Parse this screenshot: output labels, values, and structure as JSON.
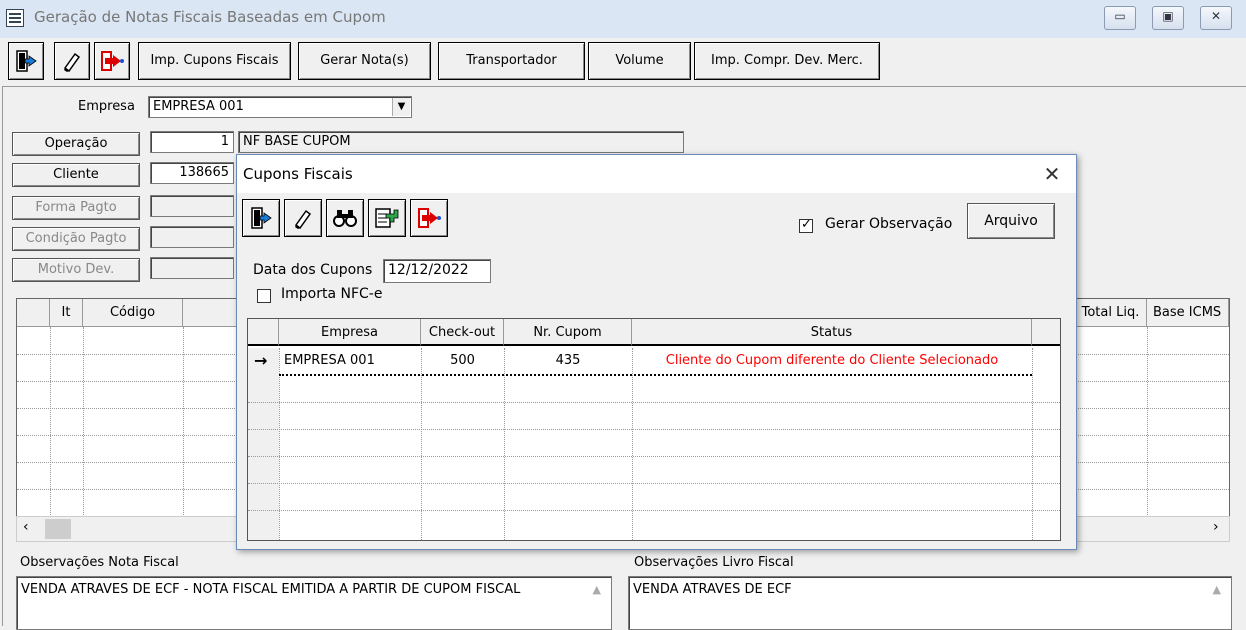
{
  "window": {
    "title": "Geração de Notas Fiscais Baseadas em Cupom",
    "minimize_icon": "minimize-icon",
    "maximize_icon": "maximize-icon",
    "close_icon": "close-icon"
  },
  "toolbar": {
    "exit_icon": "exit-door-icon",
    "clear_icon": "eraser-icon",
    "export_icon": "export-arrow-icon",
    "imp_cupons_label": "Imp. Cupons Fiscais",
    "gerar_nota_label": "Gerar Nota(s)",
    "transportador_label": "Transportador",
    "volume_label": "Volume",
    "imp_compr_label": "Imp. Compr. Dev. Merc."
  },
  "form": {
    "empresa_label": "Empresa",
    "empresa_value": "EMPRESA 001",
    "operacao_button": "Operação",
    "operacao_code": "1",
    "operacao_desc": "NF BASE CUPOM",
    "cliente_button": "Cliente",
    "cliente_code": "138665",
    "forma_pagto_button": "Forma Pagto",
    "condicao_pagto_button": "Condição Pagto",
    "motivo_dev_button": "Motivo Dev."
  },
  "items_grid": {
    "headers": {
      "it": "It",
      "codigo": "Código",
      "total_liq": "Total Liq.",
      "base_icms": "Base ICMS"
    }
  },
  "observacoes": {
    "nota_label": "Observações Nota Fiscal",
    "nota_value": "VENDA ATRAVES DE ECF - NOTA FISCAL EMITIDA A PARTIR DE CUPOM FISCAL",
    "livro_label": "Observações Livro Fiscal",
    "livro_value": "VENDA ATRAVES DE ECF"
  },
  "dialog": {
    "title": "Cupons Fiscais",
    "close_icon": "close-icon",
    "toolbar_icons": [
      "exit-door-icon",
      "eraser-icon",
      "binoculars-icon",
      "add-record-icon",
      "export-arrow-icon"
    ],
    "gerar_observacao_label": "Gerar Observação",
    "gerar_observacao_checked": true,
    "arquivo_button": "Arquivo",
    "data_label": "Data dos Cupons",
    "data_value": "12/12/2022",
    "importa_nfce_label": "Importa NFC-e",
    "importa_nfce_checked": false,
    "grid": {
      "headers": {
        "empresa": "Empresa",
        "checkout": "Check-out",
        "nr_cupom": "Nr. Cupom",
        "status": "Status"
      },
      "rows": [
        {
          "empresa": "EMPRESA 001",
          "checkout": "500",
          "nr_cupom": "435",
          "status": "Cliente do Cupom diferente do Cliente Selecionado",
          "status_color": "#ff0000"
        }
      ]
    }
  }
}
